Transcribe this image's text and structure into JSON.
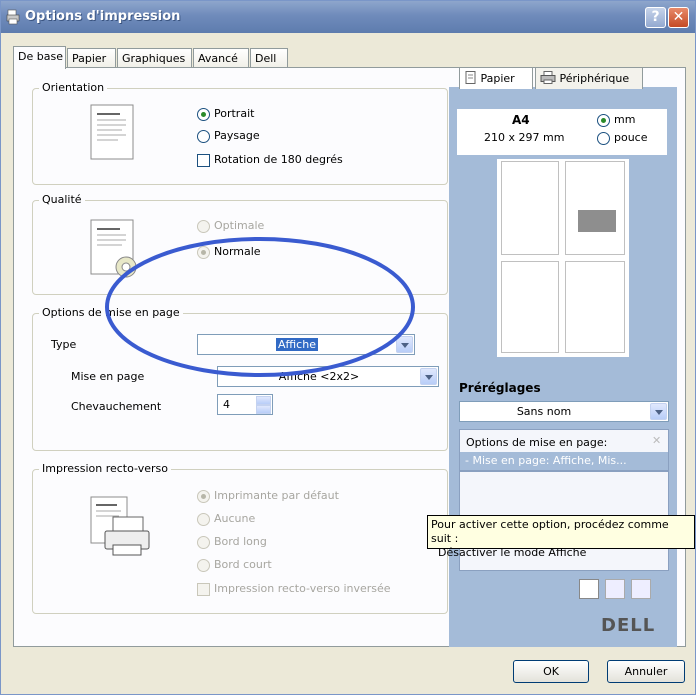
{
  "window": {
    "title": "Options d'impression",
    "help_label": "?",
    "close_label": "✕"
  },
  "tabs": [
    "De base",
    "Papier",
    "Graphiques",
    "Avancé",
    "Dell"
  ],
  "orientation": {
    "legend": "Orientation",
    "portrait": "Portrait",
    "paysage": "Paysage",
    "rotation": "Rotation de 180 degrés"
  },
  "qualite": {
    "legend": "Qualité",
    "optimale": "Optimale",
    "normale": "Normale"
  },
  "mise_en_page": {
    "legend": "Options de mise en page",
    "type_label": "Type",
    "type_value": "Affiche",
    "mise_label": "Mise en page",
    "mise_value": "Affiche <2x2>",
    "chevauchement_label": "Chevauchement",
    "chevauchement_value": "4"
  },
  "recto_verso": {
    "legend": "Impression recto-verso",
    "defaut": "Imprimante par défaut",
    "aucune": "Aucune",
    "bord_long": "Bord long",
    "bord_court": "Bord court",
    "inversee": "Impression recto-verso inversée"
  },
  "right": {
    "tab_papier": "Papier",
    "tab_peripherique": "Périphérique",
    "paper_size": "A4",
    "paper_dims": "210 x 297 mm",
    "unit_mm": "mm",
    "unit_pouce": "pouce",
    "preglages_label": "Préréglages",
    "preset_value": "Sans nom",
    "options_title": "Options de mise en page:",
    "options_item": "- Mise en page: Affiche, Mis...",
    "brand": "DELL"
  },
  "tooltip": {
    "line1": "Pour activer cette option, procédez comme suit :",
    "line2": "Désactiver le mode Affiche"
  },
  "buttons": {
    "ok": "OK",
    "annuler": "Annuler"
  },
  "colors": {
    "titlebar": "#6f8bbb",
    "right_panel": "#a4bbd8",
    "annotation_ellipse": "#3a5bd0"
  }
}
